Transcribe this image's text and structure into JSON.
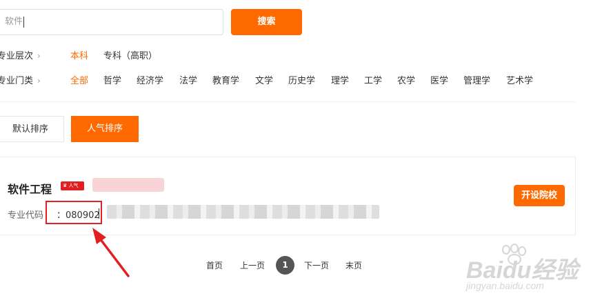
{
  "search": {
    "value": "软件",
    "button_label": "搜索"
  },
  "filters": {
    "level": {
      "label": "专业层次",
      "options": [
        "本科",
        "专科（高职）"
      ],
      "selected": "本科"
    },
    "category": {
      "label": "专业门类",
      "options": [
        "全部",
        "哲学",
        "经济学",
        "法学",
        "教育学",
        "文学",
        "历史学",
        "理学",
        "工学",
        "农学",
        "医学",
        "管理学",
        "艺术学"
      ],
      "selected": "全部"
    }
  },
  "sort": {
    "default_label": "默认排序",
    "popularity_label": "人气排序",
    "active": "人气排序"
  },
  "result": {
    "name": "软件工程",
    "badge": "人气",
    "code_label": "专业代码",
    "code_value": "：080902",
    "action_label": "开设院校"
  },
  "pagination": {
    "first": "首页",
    "prev": "上一页",
    "current": "1",
    "next": "下一页",
    "last": "末页"
  },
  "colors": {
    "accent": "#ff6a00",
    "annotation": "#e02020",
    "badge": "#e02020"
  },
  "watermark": {
    "brand": "Baidu经验",
    "url": "jingyan.baidu.com"
  }
}
